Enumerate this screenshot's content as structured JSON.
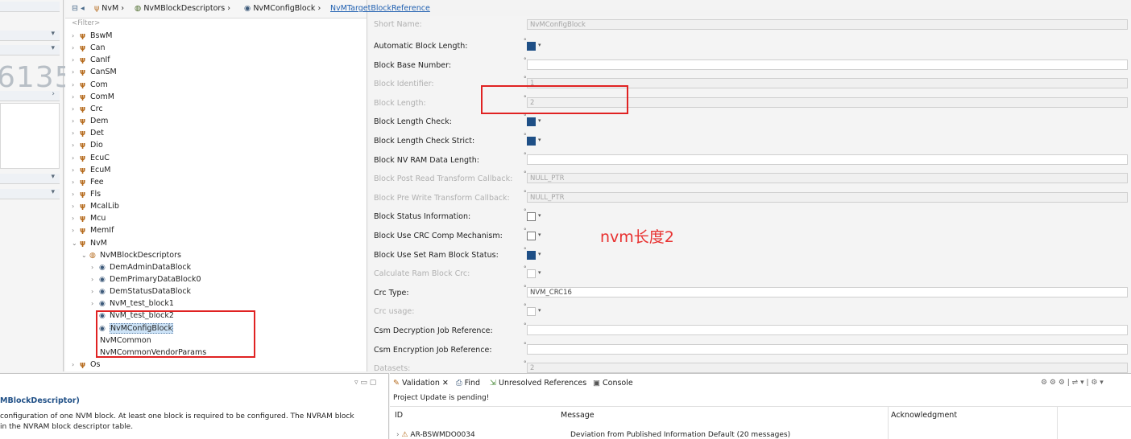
{
  "left_strip": {
    "number_fragment": "6135"
  },
  "breadcrumb": {
    "items": [
      "NvM",
      "NvMBlockDescriptors",
      "NvMConfigBlock",
      "NvMTargetBlockReference"
    ]
  },
  "tree": {
    "filter_placeholder": "<Filter>",
    "modules": [
      "BswM",
      "Can",
      "CanIf",
      "CanSM",
      "Com",
      "ComM",
      "Crc",
      "Dem",
      "Det",
      "Dio",
      "EcuC",
      "EcuM",
      "Fee",
      "Fls",
      "McalLib",
      "Mcu",
      "MemIf",
      "NvM"
    ],
    "nvm_children": {
      "descriptors_label": "NvMBlockDescriptors",
      "blocks": [
        "DemAdminDataBlock",
        "DemPrimaryDataBlock0",
        "DemStatusDataBlock",
        "NvM_test_block1",
        "NvM_test_block2",
        "NvMConfigBlock"
      ],
      "other": [
        "NvMCommon",
        "NvMCommonVendorParams"
      ]
    },
    "last_module": "Os"
  },
  "properties": {
    "short_name": {
      "label": "Short Name:",
      "value": "NvMConfigBlock"
    },
    "rows": [
      {
        "label": "Automatic Block Length:",
        "kind": "check",
        "checked": true,
        "disabled": false
      },
      {
        "label": "Block Base Number:",
        "kind": "field",
        "value": "",
        "disabled": false
      },
      {
        "label": "Block Identifier:",
        "kind": "field",
        "value": "1",
        "disabled": true
      },
      {
        "label": "Block Length:",
        "kind": "field",
        "value": "2",
        "disabled": true
      },
      {
        "label": "Block Length Check:",
        "kind": "check",
        "checked": true,
        "disabled": false
      },
      {
        "label": "Block Length Check Strict:",
        "kind": "check",
        "checked": true,
        "disabled": false
      },
      {
        "label": "Block NV RAM Data Length:",
        "kind": "field",
        "value": "",
        "disabled": false
      },
      {
        "label": "Block Post Read Transform Callback:",
        "kind": "field",
        "value": "NULL_PTR",
        "disabled": true
      },
      {
        "label": "Block Pre Write Transform Callback:",
        "kind": "field",
        "value": "NULL_PTR",
        "disabled": true
      },
      {
        "label": "Block Status Information:",
        "kind": "check",
        "checked": false,
        "disabled": false
      },
      {
        "label": "Block Use CRC Comp Mechanism:",
        "kind": "check",
        "checked": false,
        "disabled": false
      },
      {
        "label": "Block Use Set Ram Block Status:",
        "kind": "check",
        "checked": true,
        "disabled": false
      },
      {
        "label": "Calculate Ram Block Crc:",
        "kind": "check",
        "checked": false,
        "disabled": true
      },
      {
        "label": "Crc Type:",
        "kind": "field",
        "value": "NVM_CRC16",
        "disabled": false
      },
      {
        "label": "Crc usage:",
        "kind": "check",
        "checked": false,
        "disabled": true
      },
      {
        "label": "Csm Decryption Job Reference:",
        "kind": "field",
        "value": "",
        "disabled": false
      },
      {
        "label": "Csm Encryption Job Reference:",
        "kind": "field",
        "value": "",
        "disabled": false
      },
      {
        "label": "Datasets:",
        "kind": "field",
        "value": "2",
        "disabled": true
      }
    ]
  },
  "annotation": {
    "text": "nvm长度2",
    "color": "#e8302f"
  },
  "bottom_left": {
    "title": "MBlockDescriptor)",
    "description_line1": "configuration of one NVM block. At least one block is required to be configured. The NVRAM block",
    "description_line2": "in the NVRAM block descriptor table."
  },
  "bottom_right": {
    "tabs": [
      "Validation",
      "Find",
      "Unresolved References",
      "Console"
    ],
    "status": "Project Update is pending!",
    "columns": [
      "ID",
      "Message",
      "Acknowledgment"
    ],
    "rows": [
      {
        "id": "AR-BSWMDO0034",
        "message": "Deviation from Published Information Default (20 messages)"
      }
    ]
  }
}
